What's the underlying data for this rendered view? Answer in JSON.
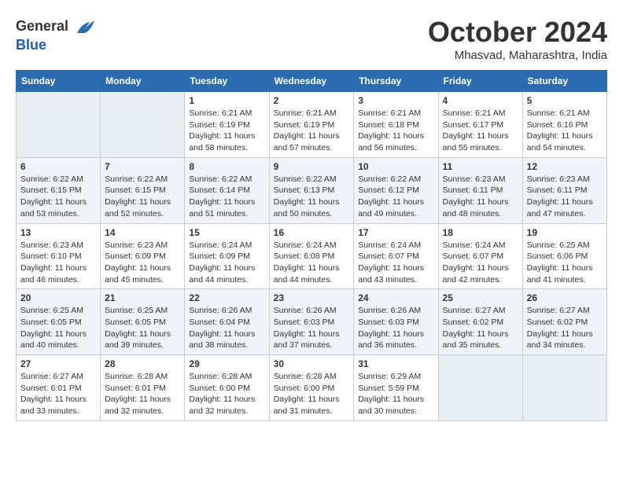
{
  "header": {
    "logo_line1": "General",
    "logo_line2": "Blue",
    "month": "October 2024",
    "location": "Mhasvad, Maharashtra, India"
  },
  "weekdays": [
    "Sunday",
    "Monday",
    "Tuesday",
    "Wednesday",
    "Thursday",
    "Friday",
    "Saturday"
  ],
  "weeks": [
    [
      {
        "day": "",
        "empty": true
      },
      {
        "day": "",
        "empty": true
      },
      {
        "day": "1",
        "sunrise": "Sunrise: 6:21 AM",
        "sunset": "Sunset: 6:19 PM",
        "daylight": "Daylight: 11 hours and 58 minutes."
      },
      {
        "day": "2",
        "sunrise": "Sunrise: 6:21 AM",
        "sunset": "Sunset: 6:19 PM",
        "daylight": "Daylight: 11 hours and 57 minutes."
      },
      {
        "day": "3",
        "sunrise": "Sunrise: 6:21 AM",
        "sunset": "Sunset: 6:18 PM",
        "daylight": "Daylight: 11 hours and 56 minutes."
      },
      {
        "day": "4",
        "sunrise": "Sunrise: 6:21 AM",
        "sunset": "Sunset: 6:17 PM",
        "daylight": "Daylight: 11 hours and 55 minutes."
      },
      {
        "day": "5",
        "sunrise": "Sunrise: 6:21 AM",
        "sunset": "Sunset: 6:16 PM",
        "daylight": "Daylight: 11 hours and 54 minutes."
      }
    ],
    [
      {
        "day": "6",
        "sunrise": "Sunrise: 6:22 AM",
        "sunset": "Sunset: 6:15 PM",
        "daylight": "Daylight: 11 hours and 53 minutes."
      },
      {
        "day": "7",
        "sunrise": "Sunrise: 6:22 AM",
        "sunset": "Sunset: 6:15 PM",
        "daylight": "Daylight: 11 hours and 52 minutes."
      },
      {
        "day": "8",
        "sunrise": "Sunrise: 6:22 AM",
        "sunset": "Sunset: 6:14 PM",
        "daylight": "Daylight: 11 hours and 51 minutes."
      },
      {
        "day": "9",
        "sunrise": "Sunrise: 6:22 AM",
        "sunset": "Sunset: 6:13 PM",
        "daylight": "Daylight: 11 hours and 50 minutes."
      },
      {
        "day": "10",
        "sunrise": "Sunrise: 6:22 AM",
        "sunset": "Sunset: 6:12 PM",
        "daylight": "Daylight: 11 hours and 49 minutes."
      },
      {
        "day": "11",
        "sunrise": "Sunrise: 6:23 AM",
        "sunset": "Sunset: 6:11 PM",
        "daylight": "Daylight: 11 hours and 48 minutes."
      },
      {
        "day": "12",
        "sunrise": "Sunrise: 6:23 AM",
        "sunset": "Sunset: 6:11 PM",
        "daylight": "Daylight: 11 hours and 47 minutes."
      }
    ],
    [
      {
        "day": "13",
        "sunrise": "Sunrise: 6:23 AM",
        "sunset": "Sunset: 6:10 PM",
        "daylight": "Daylight: 11 hours and 46 minutes."
      },
      {
        "day": "14",
        "sunrise": "Sunrise: 6:23 AM",
        "sunset": "Sunset: 6:09 PM",
        "daylight": "Daylight: 11 hours and 45 minutes."
      },
      {
        "day": "15",
        "sunrise": "Sunrise: 6:24 AM",
        "sunset": "Sunset: 6:09 PM",
        "daylight": "Daylight: 11 hours and 44 minutes."
      },
      {
        "day": "16",
        "sunrise": "Sunrise: 6:24 AM",
        "sunset": "Sunset: 6:08 PM",
        "daylight": "Daylight: 11 hours and 44 minutes."
      },
      {
        "day": "17",
        "sunrise": "Sunrise: 6:24 AM",
        "sunset": "Sunset: 6:07 PM",
        "daylight": "Daylight: 11 hours and 43 minutes."
      },
      {
        "day": "18",
        "sunrise": "Sunrise: 6:24 AM",
        "sunset": "Sunset: 6:07 PM",
        "daylight": "Daylight: 11 hours and 42 minutes."
      },
      {
        "day": "19",
        "sunrise": "Sunrise: 6:25 AM",
        "sunset": "Sunset: 6:06 PM",
        "daylight": "Daylight: 11 hours and 41 minutes."
      }
    ],
    [
      {
        "day": "20",
        "sunrise": "Sunrise: 6:25 AM",
        "sunset": "Sunset: 6:05 PM",
        "daylight": "Daylight: 11 hours and 40 minutes."
      },
      {
        "day": "21",
        "sunrise": "Sunrise: 6:25 AM",
        "sunset": "Sunset: 6:05 PM",
        "daylight": "Daylight: 11 hours and 39 minutes."
      },
      {
        "day": "22",
        "sunrise": "Sunrise: 6:26 AM",
        "sunset": "Sunset: 6:04 PM",
        "daylight": "Daylight: 11 hours and 38 minutes."
      },
      {
        "day": "23",
        "sunrise": "Sunrise: 6:26 AM",
        "sunset": "Sunset: 6:03 PM",
        "daylight": "Daylight: 11 hours and 37 minutes."
      },
      {
        "day": "24",
        "sunrise": "Sunrise: 6:26 AM",
        "sunset": "Sunset: 6:03 PM",
        "daylight": "Daylight: 11 hours and 36 minutes."
      },
      {
        "day": "25",
        "sunrise": "Sunrise: 6:27 AM",
        "sunset": "Sunset: 6:02 PM",
        "daylight": "Daylight: 11 hours and 35 minutes."
      },
      {
        "day": "26",
        "sunrise": "Sunrise: 6:27 AM",
        "sunset": "Sunset: 6:02 PM",
        "daylight": "Daylight: 11 hours and 34 minutes."
      }
    ],
    [
      {
        "day": "27",
        "sunrise": "Sunrise: 6:27 AM",
        "sunset": "Sunset: 6:01 PM",
        "daylight": "Daylight: 11 hours and 33 minutes."
      },
      {
        "day": "28",
        "sunrise": "Sunrise: 6:28 AM",
        "sunset": "Sunset: 6:01 PM",
        "daylight": "Daylight: 11 hours and 32 minutes."
      },
      {
        "day": "29",
        "sunrise": "Sunrise: 6:28 AM",
        "sunset": "Sunset: 6:00 PM",
        "daylight": "Daylight: 11 hours and 32 minutes."
      },
      {
        "day": "30",
        "sunrise": "Sunrise: 6:28 AM",
        "sunset": "Sunset: 6:00 PM",
        "daylight": "Daylight: 11 hours and 31 minutes."
      },
      {
        "day": "31",
        "sunrise": "Sunrise: 6:29 AM",
        "sunset": "Sunset: 5:59 PM",
        "daylight": "Daylight: 11 hours and 30 minutes."
      },
      {
        "day": "",
        "empty": true
      },
      {
        "day": "",
        "empty": true
      }
    ]
  ]
}
